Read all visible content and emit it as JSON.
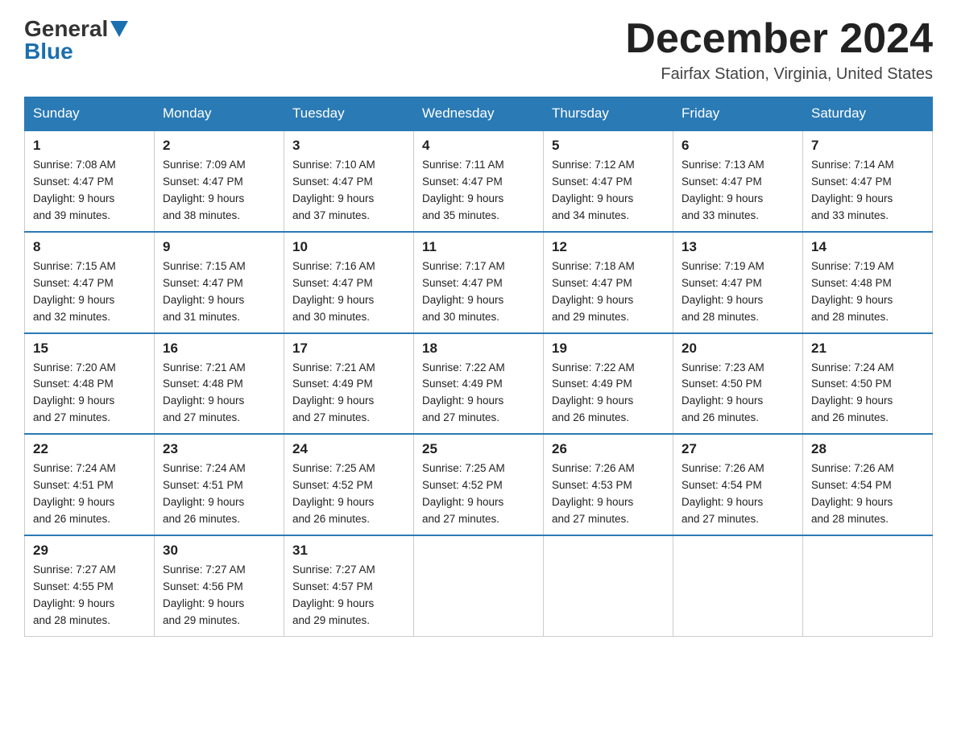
{
  "header": {
    "logo_line1": "General",
    "logo_line2": "Blue",
    "month_title": "December 2024",
    "location": "Fairfax Station, Virginia, United States"
  },
  "days_of_week": [
    "Sunday",
    "Monday",
    "Tuesday",
    "Wednesday",
    "Thursday",
    "Friday",
    "Saturday"
  ],
  "weeks": [
    [
      {
        "day": "1",
        "sunrise": "7:08 AM",
        "sunset": "4:47 PM",
        "daylight": "9 hours and 39 minutes."
      },
      {
        "day": "2",
        "sunrise": "7:09 AM",
        "sunset": "4:47 PM",
        "daylight": "9 hours and 38 minutes."
      },
      {
        "day": "3",
        "sunrise": "7:10 AM",
        "sunset": "4:47 PM",
        "daylight": "9 hours and 37 minutes."
      },
      {
        "day": "4",
        "sunrise": "7:11 AM",
        "sunset": "4:47 PM",
        "daylight": "9 hours and 35 minutes."
      },
      {
        "day": "5",
        "sunrise": "7:12 AM",
        "sunset": "4:47 PM",
        "daylight": "9 hours and 34 minutes."
      },
      {
        "day": "6",
        "sunrise": "7:13 AM",
        "sunset": "4:47 PM",
        "daylight": "9 hours and 33 minutes."
      },
      {
        "day": "7",
        "sunrise": "7:14 AM",
        "sunset": "4:47 PM",
        "daylight": "9 hours and 33 minutes."
      }
    ],
    [
      {
        "day": "8",
        "sunrise": "7:15 AM",
        "sunset": "4:47 PM",
        "daylight": "9 hours and 32 minutes."
      },
      {
        "day": "9",
        "sunrise": "7:15 AM",
        "sunset": "4:47 PM",
        "daylight": "9 hours and 31 minutes."
      },
      {
        "day": "10",
        "sunrise": "7:16 AM",
        "sunset": "4:47 PM",
        "daylight": "9 hours and 30 minutes."
      },
      {
        "day": "11",
        "sunrise": "7:17 AM",
        "sunset": "4:47 PM",
        "daylight": "9 hours and 30 minutes."
      },
      {
        "day": "12",
        "sunrise": "7:18 AM",
        "sunset": "4:47 PM",
        "daylight": "9 hours and 29 minutes."
      },
      {
        "day": "13",
        "sunrise": "7:19 AM",
        "sunset": "4:47 PM",
        "daylight": "9 hours and 28 minutes."
      },
      {
        "day": "14",
        "sunrise": "7:19 AM",
        "sunset": "4:48 PM",
        "daylight": "9 hours and 28 minutes."
      }
    ],
    [
      {
        "day": "15",
        "sunrise": "7:20 AM",
        "sunset": "4:48 PM",
        "daylight": "9 hours and 27 minutes."
      },
      {
        "day": "16",
        "sunrise": "7:21 AM",
        "sunset": "4:48 PM",
        "daylight": "9 hours and 27 minutes."
      },
      {
        "day": "17",
        "sunrise": "7:21 AM",
        "sunset": "4:49 PM",
        "daylight": "9 hours and 27 minutes."
      },
      {
        "day": "18",
        "sunrise": "7:22 AM",
        "sunset": "4:49 PM",
        "daylight": "9 hours and 27 minutes."
      },
      {
        "day": "19",
        "sunrise": "7:22 AM",
        "sunset": "4:49 PM",
        "daylight": "9 hours and 26 minutes."
      },
      {
        "day": "20",
        "sunrise": "7:23 AM",
        "sunset": "4:50 PM",
        "daylight": "9 hours and 26 minutes."
      },
      {
        "day": "21",
        "sunrise": "7:24 AM",
        "sunset": "4:50 PM",
        "daylight": "9 hours and 26 minutes."
      }
    ],
    [
      {
        "day": "22",
        "sunrise": "7:24 AM",
        "sunset": "4:51 PM",
        "daylight": "9 hours and 26 minutes."
      },
      {
        "day": "23",
        "sunrise": "7:24 AM",
        "sunset": "4:51 PM",
        "daylight": "9 hours and 26 minutes."
      },
      {
        "day": "24",
        "sunrise": "7:25 AM",
        "sunset": "4:52 PM",
        "daylight": "9 hours and 26 minutes."
      },
      {
        "day": "25",
        "sunrise": "7:25 AM",
        "sunset": "4:52 PM",
        "daylight": "9 hours and 27 minutes."
      },
      {
        "day": "26",
        "sunrise": "7:26 AM",
        "sunset": "4:53 PM",
        "daylight": "9 hours and 27 minutes."
      },
      {
        "day": "27",
        "sunrise": "7:26 AM",
        "sunset": "4:54 PM",
        "daylight": "9 hours and 27 minutes."
      },
      {
        "day": "28",
        "sunrise": "7:26 AM",
        "sunset": "4:54 PM",
        "daylight": "9 hours and 28 minutes."
      }
    ],
    [
      {
        "day": "29",
        "sunrise": "7:27 AM",
        "sunset": "4:55 PM",
        "daylight": "9 hours and 28 minutes."
      },
      {
        "day": "30",
        "sunrise": "7:27 AM",
        "sunset": "4:56 PM",
        "daylight": "9 hours and 29 minutes."
      },
      {
        "day": "31",
        "sunrise": "7:27 AM",
        "sunset": "4:57 PM",
        "daylight": "9 hours and 29 minutes."
      },
      null,
      null,
      null,
      null
    ]
  ],
  "labels": {
    "sunrise": "Sunrise:",
    "sunset": "Sunset:",
    "daylight": "Daylight:"
  }
}
